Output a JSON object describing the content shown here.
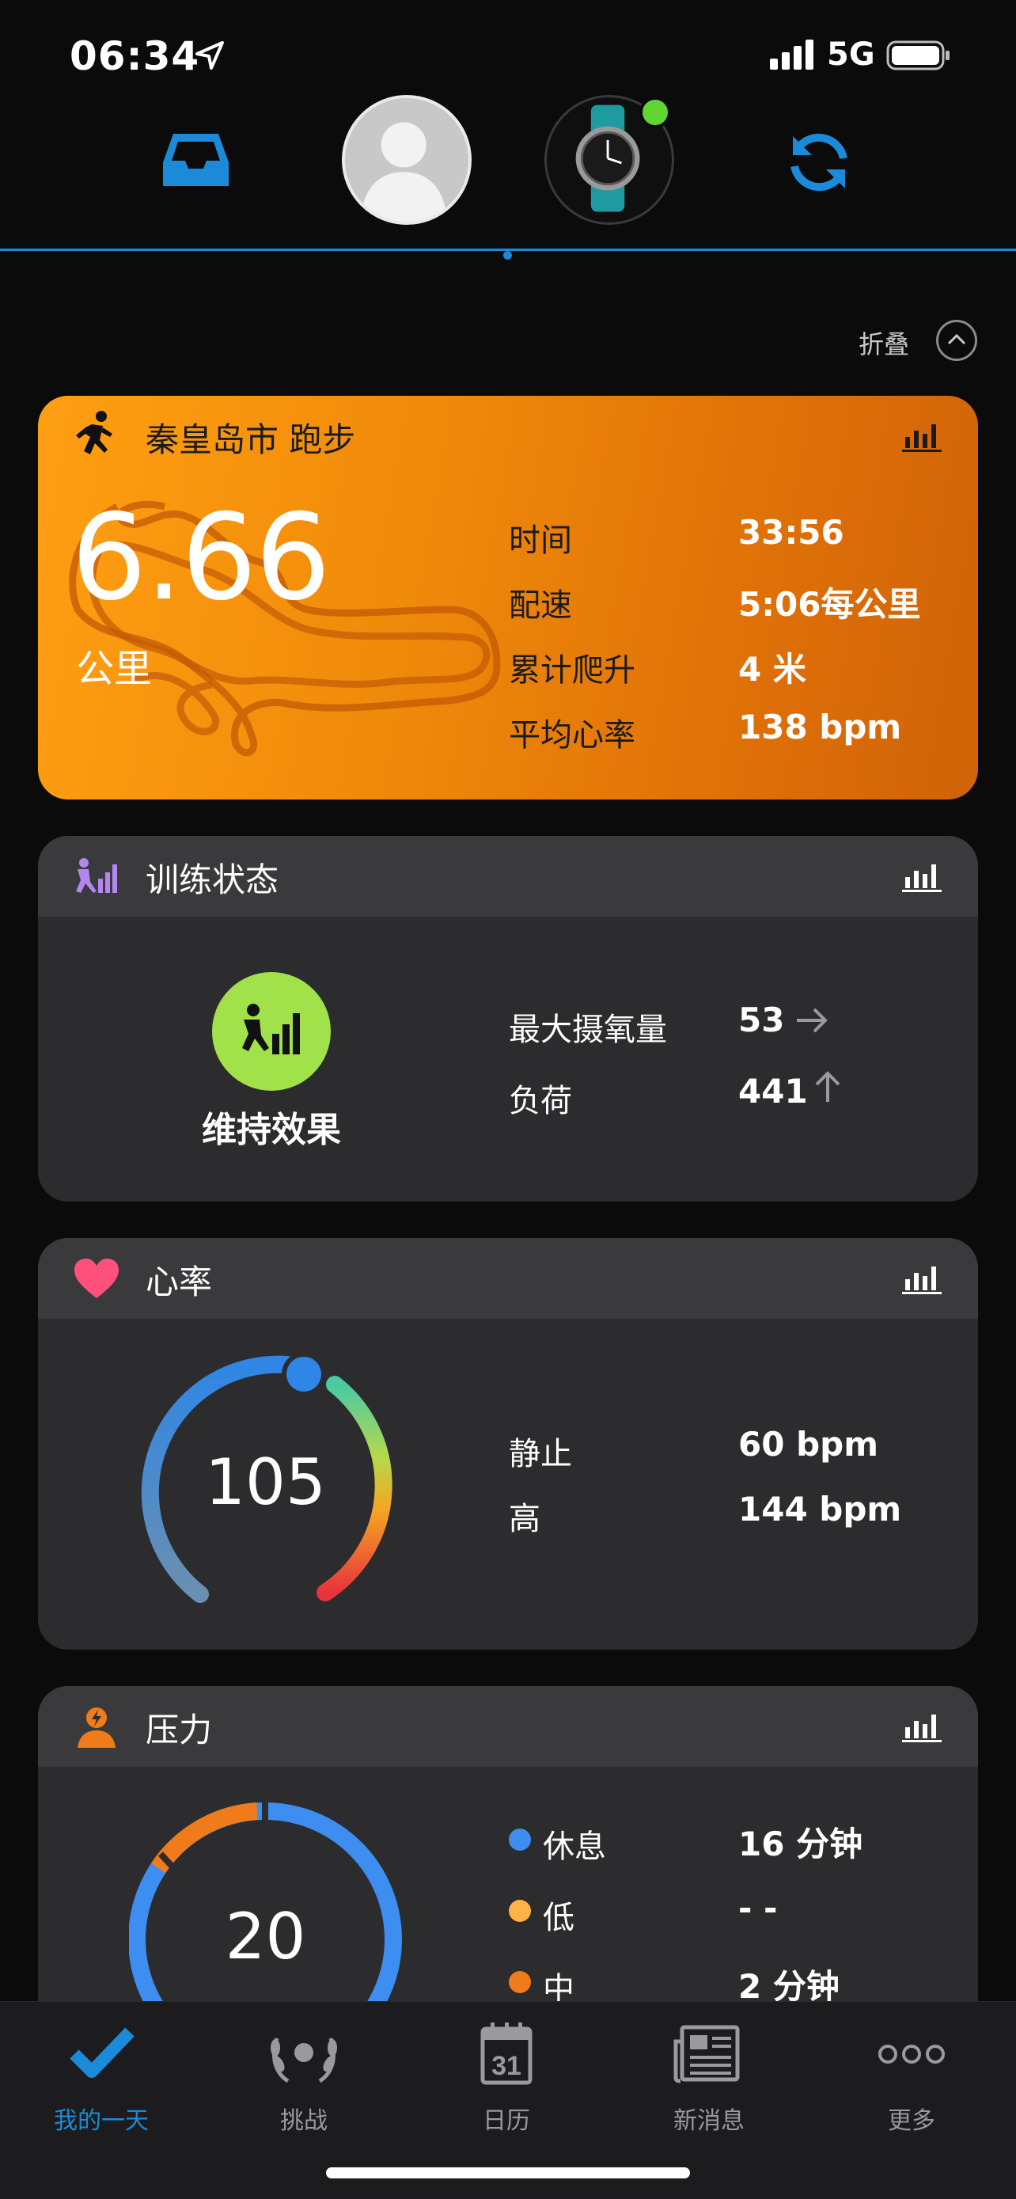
{
  "status_bar": {
    "time": "06:34",
    "network": "5G"
  },
  "header": {
    "collapse_label": "折叠"
  },
  "run_card": {
    "title": "秦皇岛市 跑步",
    "distance": "6.66",
    "distance_unit": "公里",
    "stats": [
      {
        "label": "时间",
        "value": "33:56"
      },
      {
        "label": "配速",
        "value": "5:06每公里"
      },
      {
        "label": "累计爬升",
        "value": "4 米"
      },
      {
        "label": "平均心率",
        "value": "138 bpm"
      }
    ],
    "accent_color": "#f28c0c"
  },
  "training_card": {
    "title": "训练状态",
    "result": "维持效果",
    "stats": [
      {
        "label": "最大摄氧量",
        "value": "53",
        "trend": "right-arrow"
      },
      {
        "label": "负荷",
        "value": "441",
        "trend": "up-arrow"
      }
    ],
    "badge_color": "#a1e14a"
  },
  "heart_card": {
    "title": "心率",
    "current": "105",
    "stats": [
      {
        "label": "静止",
        "value": "60 bpm"
      },
      {
        "label": "高",
        "value": "144 bpm"
      }
    ]
  },
  "stress_card": {
    "title": "压力",
    "current": "20",
    "legend": [
      {
        "label": "休息",
        "value": "16 分钟",
        "color": "#3d8ef0"
      },
      {
        "label": "低",
        "value": "- -",
        "color": "#ffb347"
      },
      {
        "label": "中",
        "value": "2 分钟",
        "color": "#f07b1a"
      }
    ]
  },
  "tabs": [
    {
      "label": "我的一天",
      "icon": "check-icon",
      "active": true
    },
    {
      "label": "挑战",
      "icon": "laurel-icon",
      "active": false
    },
    {
      "label": "日历",
      "icon": "calendar-icon",
      "active": false,
      "calendar_day": "31"
    },
    {
      "label": "新消息",
      "icon": "newspaper-icon",
      "active": false
    },
    {
      "label": "更多",
      "icon": "more-icon",
      "active": false
    }
  ],
  "colors": {
    "accent_blue": "#1b8ad8",
    "device_online": "#61d633"
  }
}
